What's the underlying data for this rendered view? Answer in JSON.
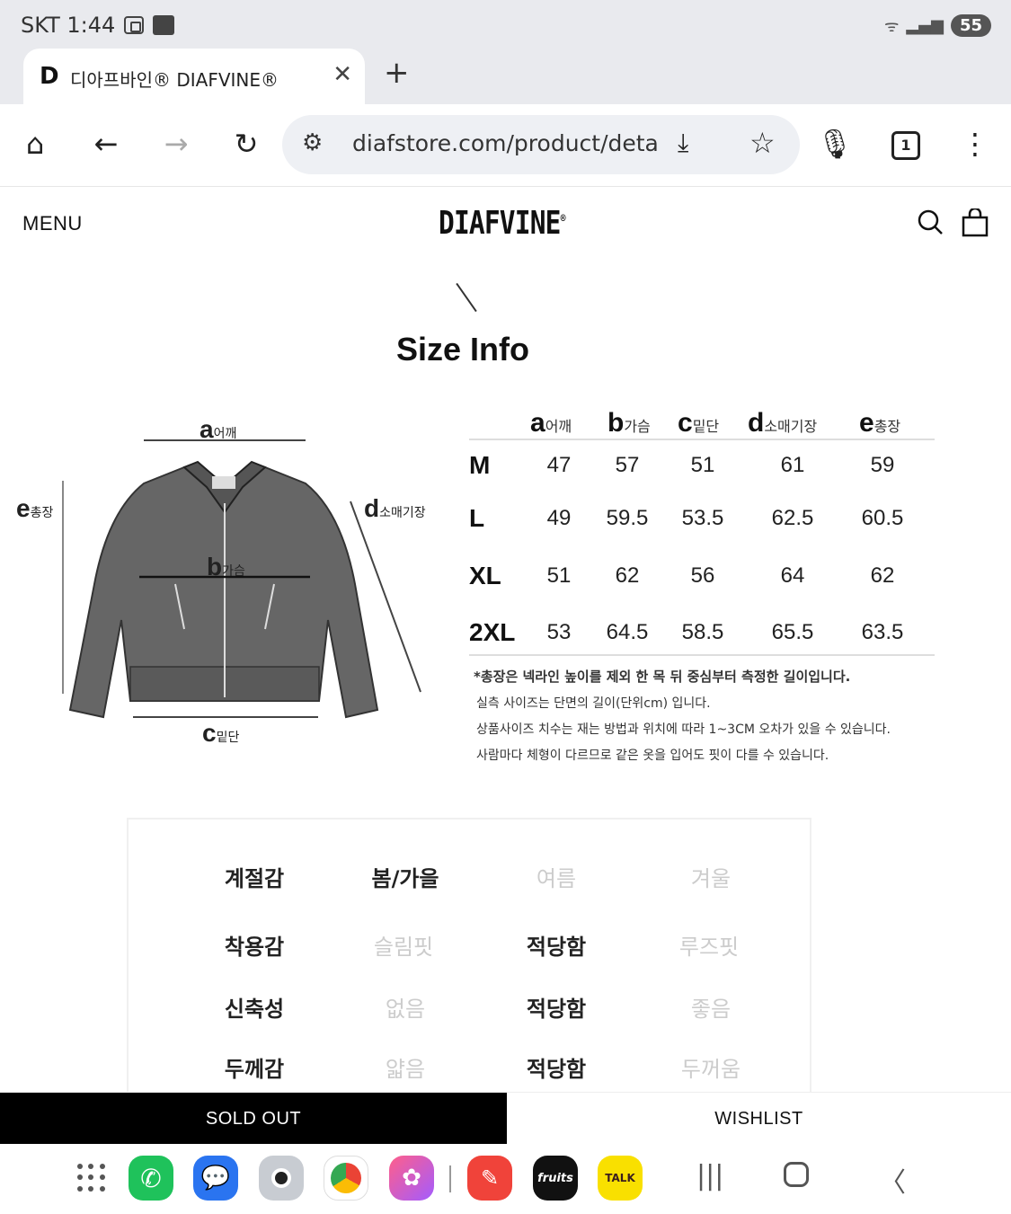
{
  "status_bar": {
    "carrier_time": "SKT 1:44",
    "battery": "55"
  },
  "browser": {
    "tab_title": "디아프바인® DIAFVINE®",
    "tab_favicon": "D",
    "url": "diafstore.com/product/detai",
    "tab_count": "1"
  },
  "site": {
    "menu_label": "MENU",
    "logo": "DIAFVINE"
  },
  "size_info": {
    "title": "Size Info",
    "diagram_labels": {
      "a": {
        "letter": "a",
        "text": "어깨"
      },
      "b": {
        "letter": "b",
        "text": "가슴"
      },
      "c": {
        "letter": "c",
        "text": "밑단"
      },
      "d": {
        "letter": "d",
        "text": "소매기장"
      },
      "e": {
        "letter": "e",
        "text": "총장"
      }
    },
    "columns": [
      {
        "letter": "a",
        "text": "어깨"
      },
      {
        "letter": "b",
        "text": "가슴"
      },
      {
        "letter": "c",
        "text": "밑단"
      },
      {
        "letter": "d",
        "text": "소매기장"
      },
      {
        "letter": "e",
        "text": "총장"
      }
    ],
    "rows": [
      {
        "size": "M",
        "values": [
          "47",
          "57",
          "51",
          "61",
          "59"
        ]
      },
      {
        "size": "L",
        "values": [
          "49",
          "59.5",
          "53.5",
          "62.5",
          "60.5"
        ]
      },
      {
        "size": "XL",
        "values": [
          "51",
          "62",
          "56",
          "64",
          "62"
        ]
      },
      {
        "size": "2XL",
        "values": [
          "53",
          "64.5",
          "58.5",
          "65.5",
          "63.5"
        ]
      }
    ],
    "notes": [
      "*총장은 넥라인 높이를 제외 한 목 뒤 중심부터 측정한 길이입니다.",
      "실측 사이즈는 단면의 길이(단위cm) 입니다.",
      "상품사이즈 치수는 재는 방법과 위치에 따라 1~3CM 오차가 있을 수 있습니다.",
      "사람마다 체형이 다르므로 같은 옷을 입어도 핏이 다를 수 있습니다."
    ]
  },
  "feel": [
    {
      "label": "계절감",
      "options": [
        "봄/가을",
        "여름",
        "겨울"
      ],
      "selected": [
        0
      ]
    },
    {
      "label": "착용감",
      "options": [
        "슬림핏",
        "적당함",
        "루즈핏"
      ],
      "selected": [
        1
      ]
    },
    {
      "label": "신축성",
      "options": [
        "없음",
        "적당함",
        "좋음"
      ],
      "selected": [
        1
      ]
    },
    {
      "label": "두께감",
      "options": [
        "얇음",
        "적당함",
        "두꺼움"
      ],
      "selected": [
        1
      ]
    }
  ],
  "actions": {
    "sold_out": "SOLD OUT",
    "wishlist": "WISHLIST"
  },
  "taskbar": {
    "talk_label": "TALK",
    "fruits_label": "fruits"
  },
  "colors": {
    "sold_out_bg": "#000000",
    "status_bg": "#e9eaee"
  }
}
